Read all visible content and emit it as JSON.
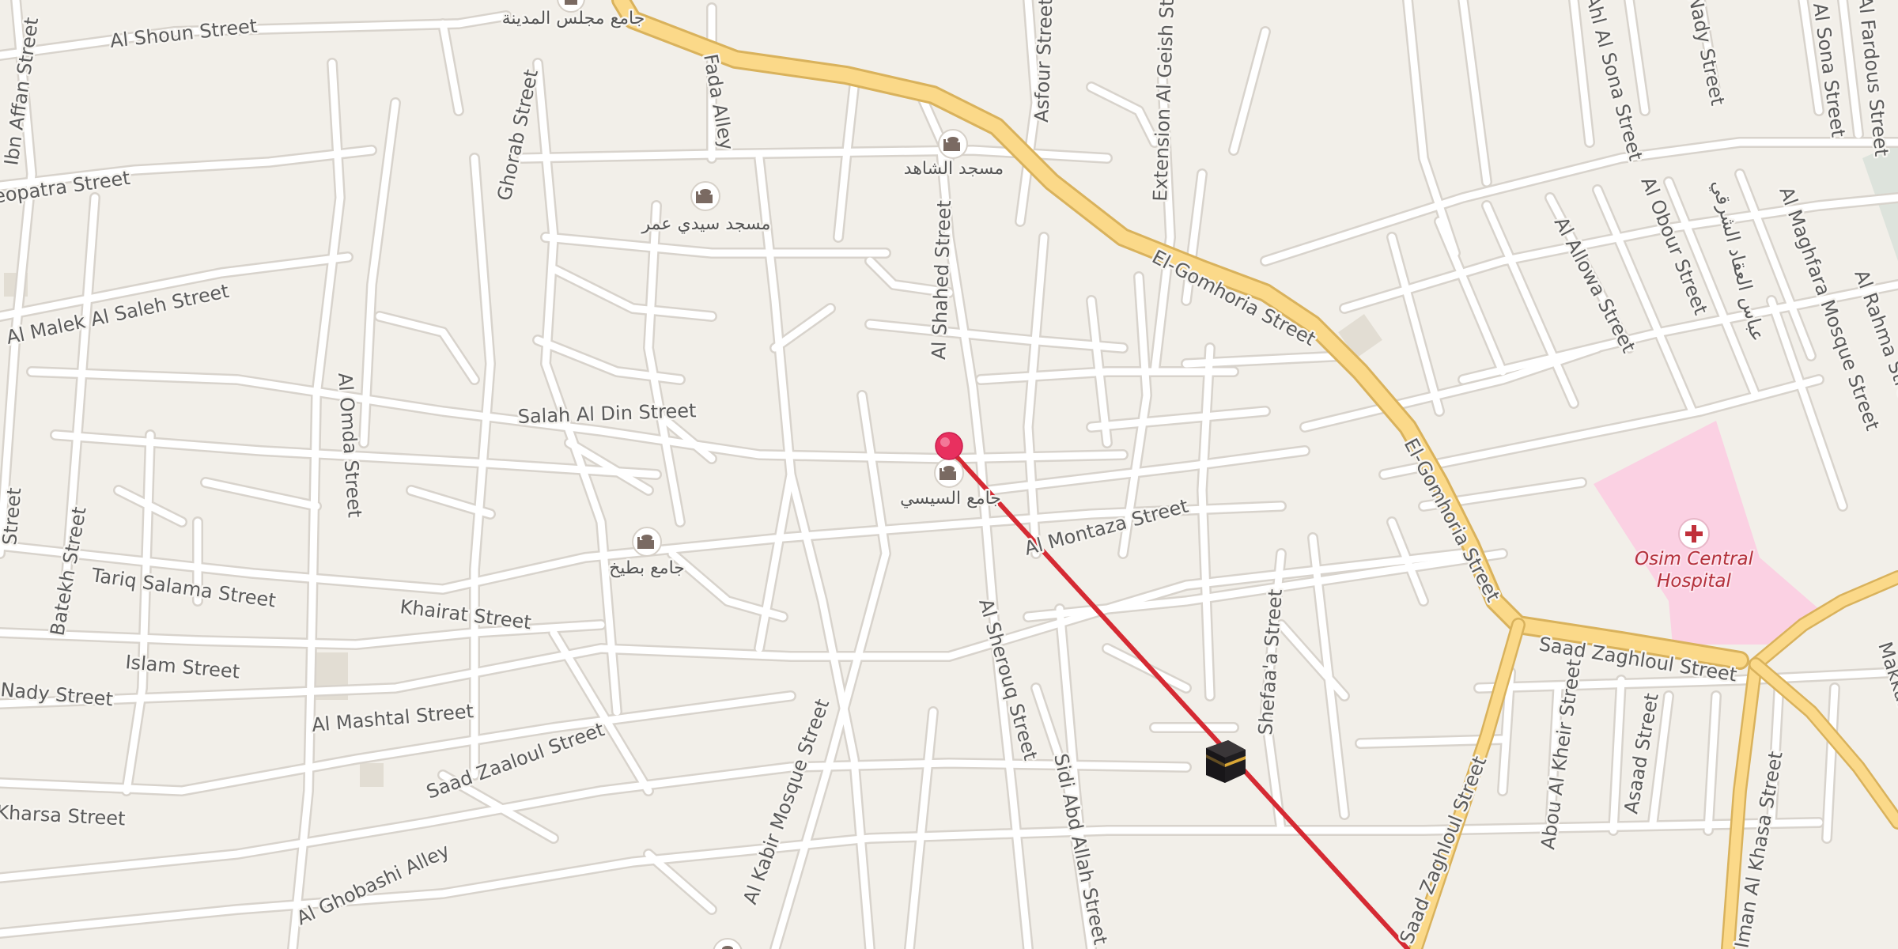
{
  "map": {
    "colors": {
      "land": "#f2efe9",
      "road": "#ffffff",
      "road_casing": "#d8d3cc",
      "primary_road": "#fbd989",
      "primary_casing": "#d9b25c",
      "hospital_area": "#fbd1e3",
      "qibla_line": "#d52a33",
      "pin": "#e8305f",
      "poi_icon": "#7a6a62"
    },
    "qibla_line": "qibla-direction-line",
    "pin": "selected-location-pin",
    "kaaba_icon": "kaaba-icon"
  },
  "streets": {
    "al_shoun": "Al Shoun Street",
    "affan": "Ibn Affan Street",
    "cleopatra": "Cleopatra Street",
    "al_malek": "Al Malek Al Saleh Street",
    "gohrab": "Ghorab Street",
    "fada": "Fada Alley",
    "asfour": "Asfour Street",
    "ext_geish": "Extension Al Geish Street",
    "gomhoria_1": "El-Gomhoria Street",
    "gomhoria_2": "El-Gomhoria Street",
    "shahed": "Al Shahed Street",
    "salah": "Salah Al Din Street",
    "omda": "Al Omda Street",
    "batekh": "Batekh Street",
    "tariq": "Tariq Salama Street",
    "khairat": "Khairat Street",
    "islam": "Islam Street",
    "nady_w": "Nady Street",
    "mashtal": "Al Mashtal Street",
    "zaaloul": "Saad Zaaloul Street",
    "kharsa": "Kharsa Street",
    "ghobashi": "Al Ghobashi Alley",
    "kabir": "Al Kabir Mosque Street",
    "montaza": "Al Montaza Street",
    "sherouq": "Al Sherouq Street",
    "sidi_abd": "Sidi Abd Allah Street",
    "shefaa": "Shefaa'a Street",
    "saad_zaghloul_h": "Saad Zaghloul Street",
    "saad_zaghloul_v": "Saad Zaghloul Street",
    "abou_kheir": "Abou Al Kheir Street",
    "asaad": "Asaad Street",
    "iman_khasa": "Iman Al Khasa Street",
    "ahl_sona": "Ahl Al Sona Street",
    "nady_e": "Nady Street",
    "al_sona": "Al Sona Street",
    "fardous": "Al Fardous Street",
    "allowa": "Al Allowa Street",
    "obour": "Al Obour Street",
    "arabic_road": "عباس العقاد الشرقي",
    "maghfara": "Al Maghfara Mosque Street",
    "rahma": "Al Rahma Street",
    "makkah": "Makkah",
    "left_edge": "Street"
  },
  "pois": {
    "majlis": "جامع مجلس المدينة",
    "shahed_mosque": "مسجد الشاهد",
    "sidi_omar": "مسجد سيدي عمر",
    "sisi": "جامع السيسي",
    "bateekh": "جامع بطيخ",
    "hospital_line1": "Osim Central",
    "hospital_line2": "Hospital"
  }
}
